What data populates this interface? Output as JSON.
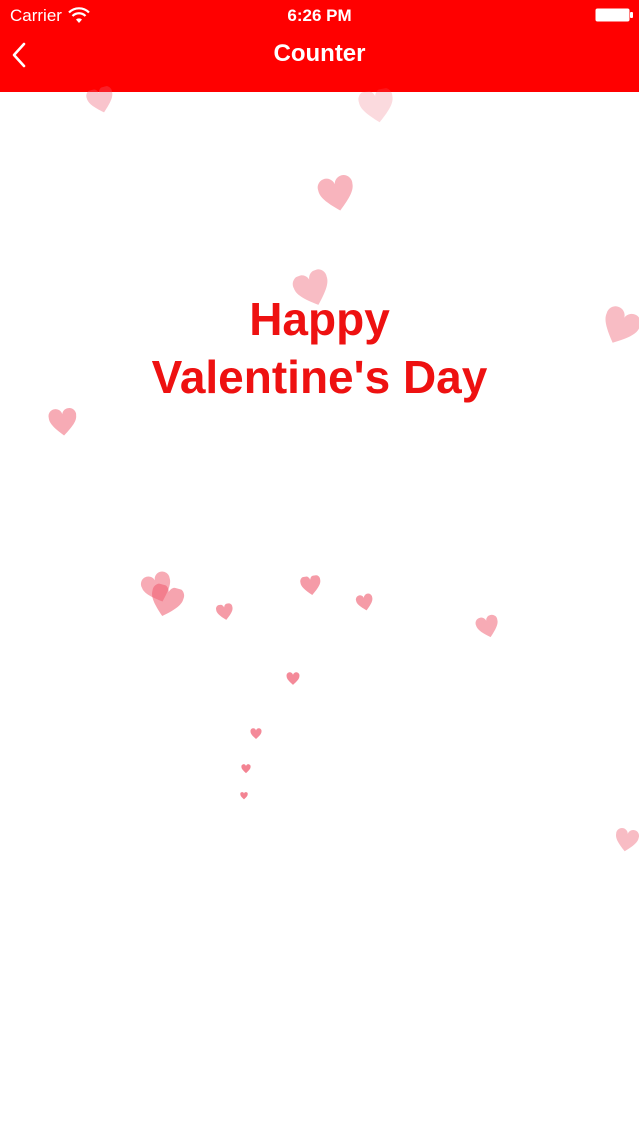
{
  "status_bar": {
    "carrier": "Carrier",
    "time": "6:26 PM",
    "wifi_icon": "wifi-icon",
    "battery_icon": "battery-icon"
  },
  "nav": {
    "title": "Counter",
    "back_icon": "chevron-left-icon",
    "background_color": "#ff0000"
  },
  "message": {
    "line1": "Happy",
    "line2": "Valentine's Day",
    "color": "#ee1111"
  },
  "decoration": {
    "icon": "heart-icon",
    "color": "#f05a6e"
  }
}
